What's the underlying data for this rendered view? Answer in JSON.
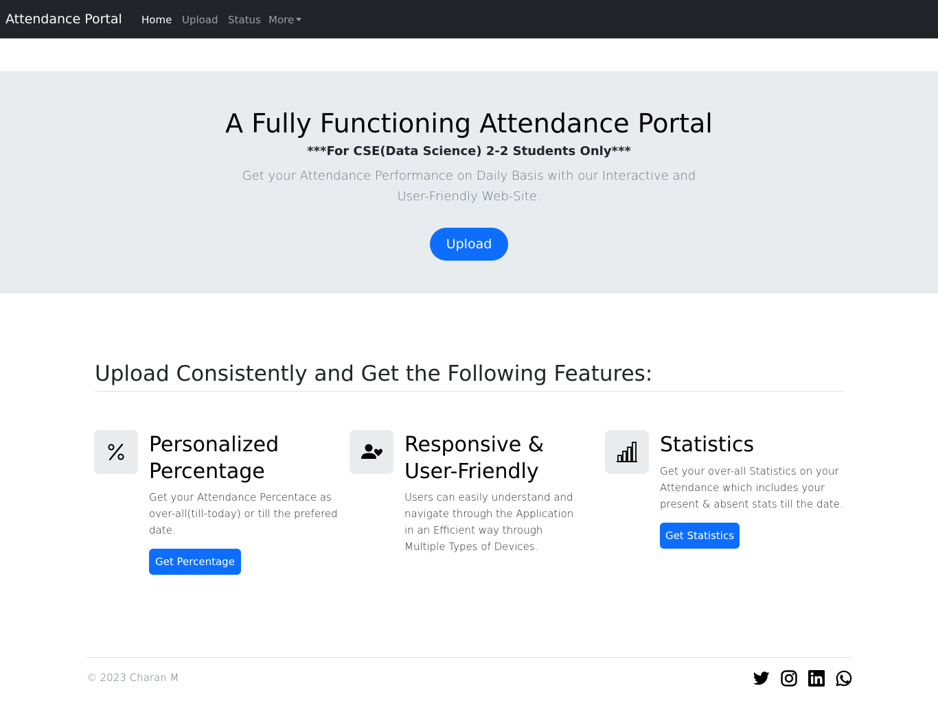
{
  "navbar": {
    "brand": "Attendance Portal",
    "links": [
      {
        "label": "Home",
        "active": true
      },
      {
        "label": "Upload",
        "active": false
      },
      {
        "label": "Status",
        "active": false
      },
      {
        "label": "More",
        "active": false,
        "dropdown": true
      }
    ]
  },
  "hero": {
    "title": "A Fully Functioning Attendance Portal",
    "subtitle": "***For CSE(Data Science) 2-2 Students Only***",
    "lead": "Get your Attendance Performance on Daily Basis with our Interactive and User-Friendly Web-Site.",
    "button": "Upload"
  },
  "features": {
    "heading": "Upload Consistently and Get the Following Features:",
    "items": [
      {
        "icon": "percent-icon",
        "title": "Personalized Percentage",
        "text": "Get your Attendance Percentace as over-all(till-today) or till the prefered date.",
        "button": "Get Percentage"
      },
      {
        "icon": "person-heart-icon",
        "title": "Responsive & User-Friendly",
        "text": "Users can easily understand and navigate through the Application in an Efficient way through Multiple Types of Devices.",
        "button": ""
      },
      {
        "icon": "bar-chart-icon",
        "title": "Statistics",
        "text": "Get your over-all Statistics on your Attendance which includes your present & absent stats till the date.",
        "button": "Get Statistics"
      }
    ]
  },
  "footer": {
    "copyright": "© 2023 Charan M",
    "social": [
      "twitter-icon",
      "instagram-icon",
      "linkedin-icon",
      "whatsapp-icon"
    ]
  },
  "colors": {
    "navbar": "#212529",
    "hero_bg": "#e9ecef",
    "primary": "#0d6efd"
  }
}
